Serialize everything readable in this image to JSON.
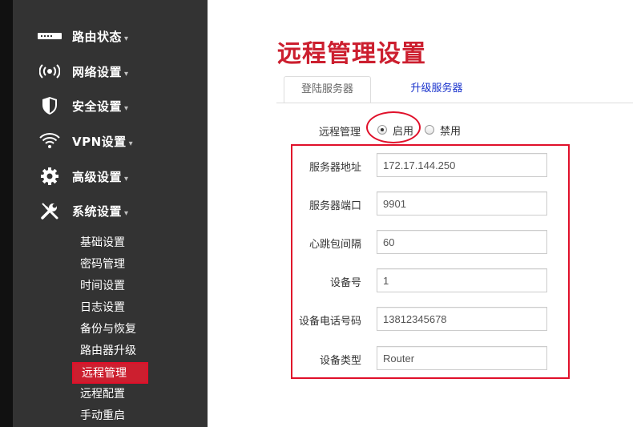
{
  "sidebar": {
    "menu": [
      {
        "label": "路由状态",
        "icon": "router-icon"
      },
      {
        "label": "网络设置",
        "icon": "wireless-broadcast-icon"
      },
      {
        "label": "安全设置",
        "icon": "shield-icon"
      },
      {
        "label": "VPN设置",
        "icon": "wifi-icon"
      },
      {
        "label": "高级设置",
        "icon": "gear-icon"
      },
      {
        "label": "系统设置",
        "icon": "wrench-screwdriver-icon"
      }
    ],
    "caret": "▾",
    "submenu": [
      "基础设置",
      "密码管理",
      "时间设置",
      "日志设置",
      "备份与恢复",
      "路由器升级",
      "远程管理",
      "远程配置",
      "手动重启"
    ],
    "active_submenu": "远程管理"
  },
  "main": {
    "title": "远程管理设置",
    "tabs": [
      "登陆服务器",
      "升级服务器"
    ],
    "active_tab": "登陆服务器",
    "remote_label": "远程管理",
    "enable_label": "启用",
    "disable_label": "禁用",
    "remote_enabled": true,
    "fields": [
      {
        "label": "服务器地址",
        "value": "172.17.144.250"
      },
      {
        "label": "服务器端口",
        "value": "9901"
      },
      {
        "label": "心跳包间隔",
        "value": "60"
      },
      {
        "label": "设备号",
        "value": "1"
      },
      {
        "label": "设备电话号码",
        "value": "13812345678"
      },
      {
        "label": "设备类型",
        "value": "Router"
      }
    ]
  },
  "colors": {
    "sidebar_bg": "#333333",
    "accent_red": "#cc1f2f",
    "tab_link": "#1a33cc"
  }
}
